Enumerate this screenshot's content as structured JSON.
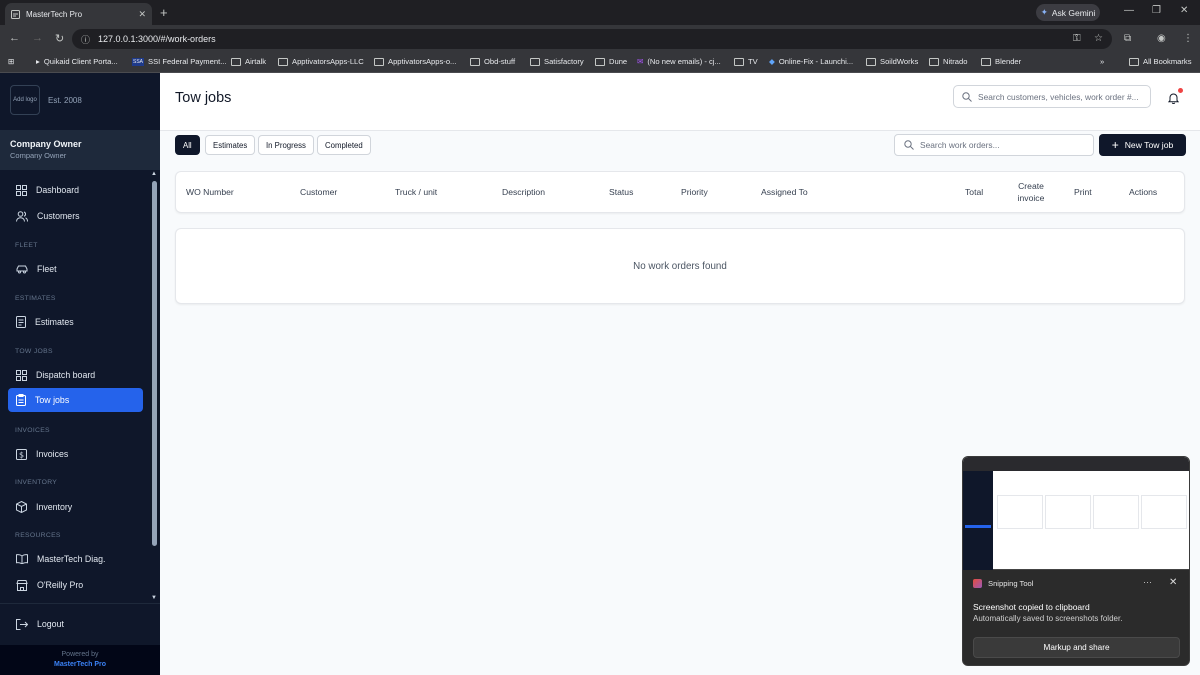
{
  "browser": {
    "tab_title": "MasterTech Pro",
    "new_tab": "+",
    "ask_gemini": "Ask Gemini",
    "url": "127.0.0.1:3000/#/work-orders",
    "bookmarks": [
      "Quikaid Client Porta...",
      "SSI Federal Payment...",
      "Airtalk",
      "ApptivatorsApps-LLC",
      "ApptivatorsApps-o...",
      "Obd-stuff",
      "Satisfactory",
      "Dune",
      "(No new emails) - cj...",
      "TV",
      "Online-Fix - Launchi...",
      "SoildWorks",
      "Nitrado",
      "Blender"
    ],
    "all_bookmarks": "All Bookmarks"
  },
  "sidebar": {
    "logo_placeholder": "Add logo",
    "est": "Est. 2008",
    "user_name": "Company Owner",
    "user_role": "Company Owner",
    "items": [
      {
        "label": "Dashboard",
        "icon": "grid-icon"
      },
      {
        "label": "Customers",
        "icon": "users-icon"
      },
      {
        "section": "FLEET"
      },
      {
        "label": "Fleet",
        "icon": "car-icon"
      },
      {
        "section": "ESTIMATES"
      },
      {
        "label": "Estimates",
        "icon": "document-icon"
      },
      {
        "section": "TOW JOBS"
      },
      {
        "label": "Dispatch board",
        "icon": "grid-icon"
      },
      {
        "label": "Tow jobs",
        "icon": "clipboard-icon",
        "active": true
      },
      {
        "section": "INVOICES"
      },
      {
        "label": "Invoices",
        "icon": "dollar-icon"
      },
      {
        "section": "INVENTORY"
      },
      {
        "label": "Inventory",
        "icon": "box-icon"
      },
      {
        "section": "RESOURCES"
      },
      {
        "label": "MasterTech Diag.",
        "icon": "book-icon"
      },
      {
        "label": "O'Reilly Pro",
        "icon": "store-icon"
      }
    ],
    "logout": "Logout",
    "powered_by": "Powered by",
    "powered_brand": "MasterTech Pro",
    "active_color": "#2563eb"
  },
  "header": {
    "title": "Tow jobs",
    "global_search_placeholder": "Search customers, vehicles, work order #..."
  },
  "filters": [
    "All",
    "Estimates",
    "In Progress",
    "Completed"
  ],
  "active_filter": "All",
  "work_search_placeholder": "Search work orders...",
  "new_button": "New Tow job",
  "table": {
    "columns": [
      "WO Number",
      "Customer",
      "Truck / unit",
      "Description",
      "Status",
      "Priority",
      "Assigned To",
      "Total",
      "Create invoice",
      "Print",
      "Actions"
    ],
    "empty_message": "No work orders found"
  },
  "toast": {
    "app": "Snipping Tool",
    "message": "Screenshot copied to clipboard",
    "sub": "Automatically saved to screenshots folder.",
    "button": "Markup and share"
  }
}
